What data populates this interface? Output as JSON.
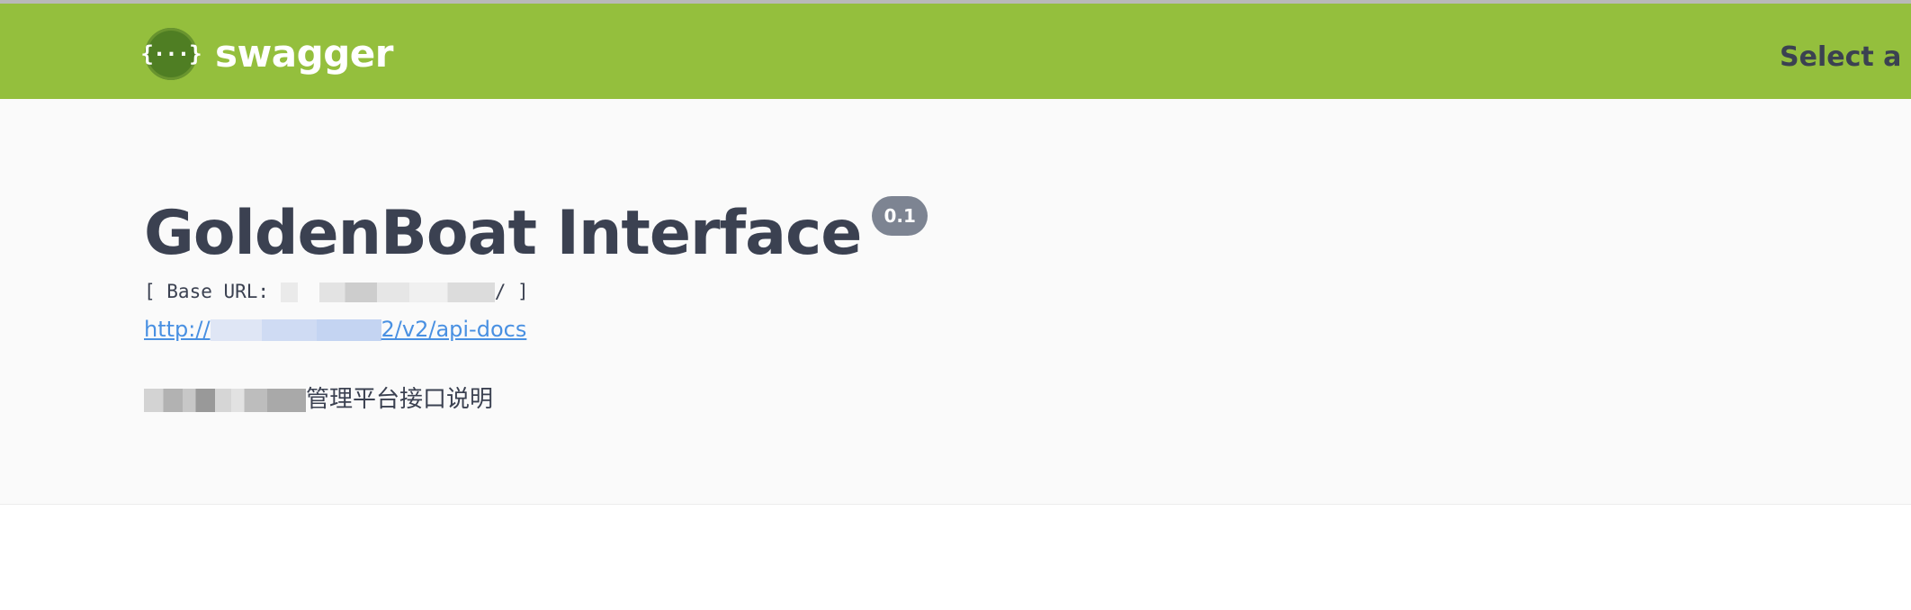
{
  "topbar": {
    "logo_glyph": "{···}",
    "brand": "swagger",
    "spec_selector_label": "Select a sp"
  },
  "info": {
    "title": "GoldenBoat Interface",
    "version": "0.1",
    "base_url_prefix": "[ Base URL: ",
    "base_url_suffix": "/ ]",
    "docs_link_prefix": "http://",
    "docs_link_suffix": "2/v2/api-docs",
    "description_visible": "管理平台接口说明"
  },
  "colors": {
    "topbar_bg": "#94bf3d",
    "logo_circle": "#4f7e23",
    "text_dark": "#3b4151",
    "version_badge": "#7d8492",
    "link": "#4990e2",
    "info_bg": "#fafafa"
  },
  "icons": {
    "logo": "swagger-logo-icon"
  }
}
